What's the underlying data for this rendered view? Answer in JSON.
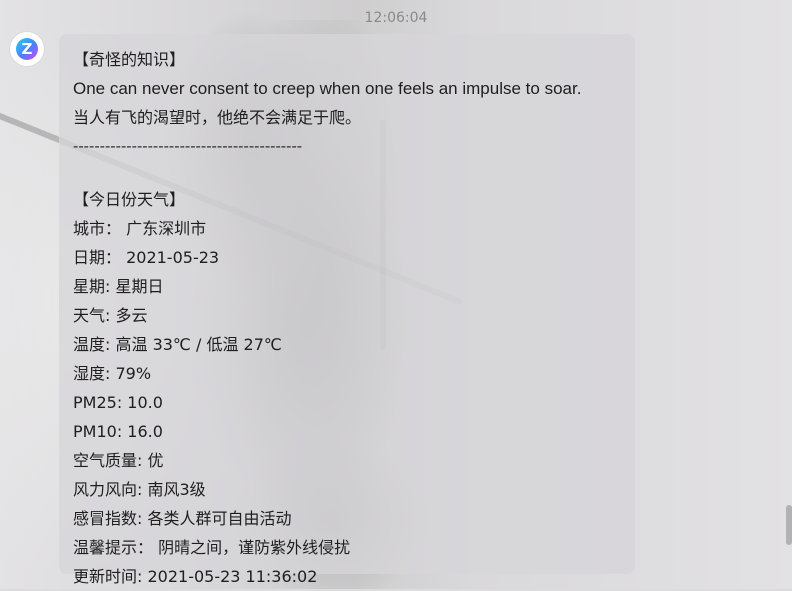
{
  "chat": {
    "timestamp": "12:06:04",
    "avatar_letter": "Z",
    "message_lines": [
      "【奇怪的知识】",
      "One can never consent to creep when one feels an impulse to soar.",
      "当人有飞的渴望时，他绝不会满足于爬。",
      "-------------------------------------------",
      "",
      "【今日份天气】",
      "城市：  广东深圳市",
      "日期：  2021-05-23",
      "星期: 星期日",
      "天气: 多云",
      "温度: 高温 33℃ / 低温 27℃",
      "湿度: 79%",
      "PM25: 10.0",
      "PM10: 16.0",
      "空气质量: 优",
      "风力风向: 南风3级",
      "感冒指数: 各类人群可自由活动",
      "温馨提示：  阴晴之间，谨防紫外线侵扰",
      "更新时间: 2021-05-23 11:36:02"
    ]
  },
  "colors": {
    "bubble_bg": "#d6d5d8",
    "text": "#1e1e1e",
    "timestamp": "#8a8a8a"
  },
  "icons": {
    "avatar": "app-logo-z-icon"
  }
}
